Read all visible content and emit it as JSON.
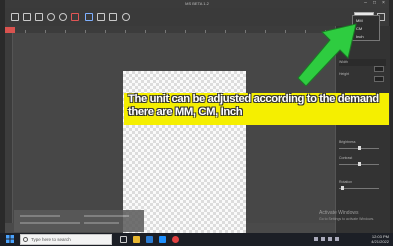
{
  "window": {
    "title": "MS BETA 1.2"
  },
  "toolbar": {
    "icons": [
      "new-file-icon",
      "open-icon",
      "save-icon",
      "undo-icon",
      "redo-icon",
      "brush-icon",
      "grid-icon",
      "align-icon",
      "crop-icon",
      "settings-icon"
    ],
    "unit_value": "MM"
  },
  "unit_dropdown": {
    "options": [
      "MM",
      "CM",
      "Inch"
    ]
  },
  "caption": {
    "line1": "The unit can be adjusted according to the demand",
    "line2": "there are MM, CM, Inch",
    "colors": {
      "band": "#f5ef00",
      "text": "#ffffff"
    }
  },
  "arrow": {
    "color": "#2ecc40"
  },
  "right_panel": {
    "header": "Width",
    "header2": "Height",
    "section_a": "Brightness",
    "section_b": "Contrast",
    "section_c": "Rotation"
  },
  "watermark": {
    "line1": "Activate Windows",
    "line2": "Go to Settings to activate Windows."
  },
  "taskbar": {
    "search_placeholder": "Type here to search",
    "time": "12:03 PM",
    "date": "4/21/2022"
  }
}
